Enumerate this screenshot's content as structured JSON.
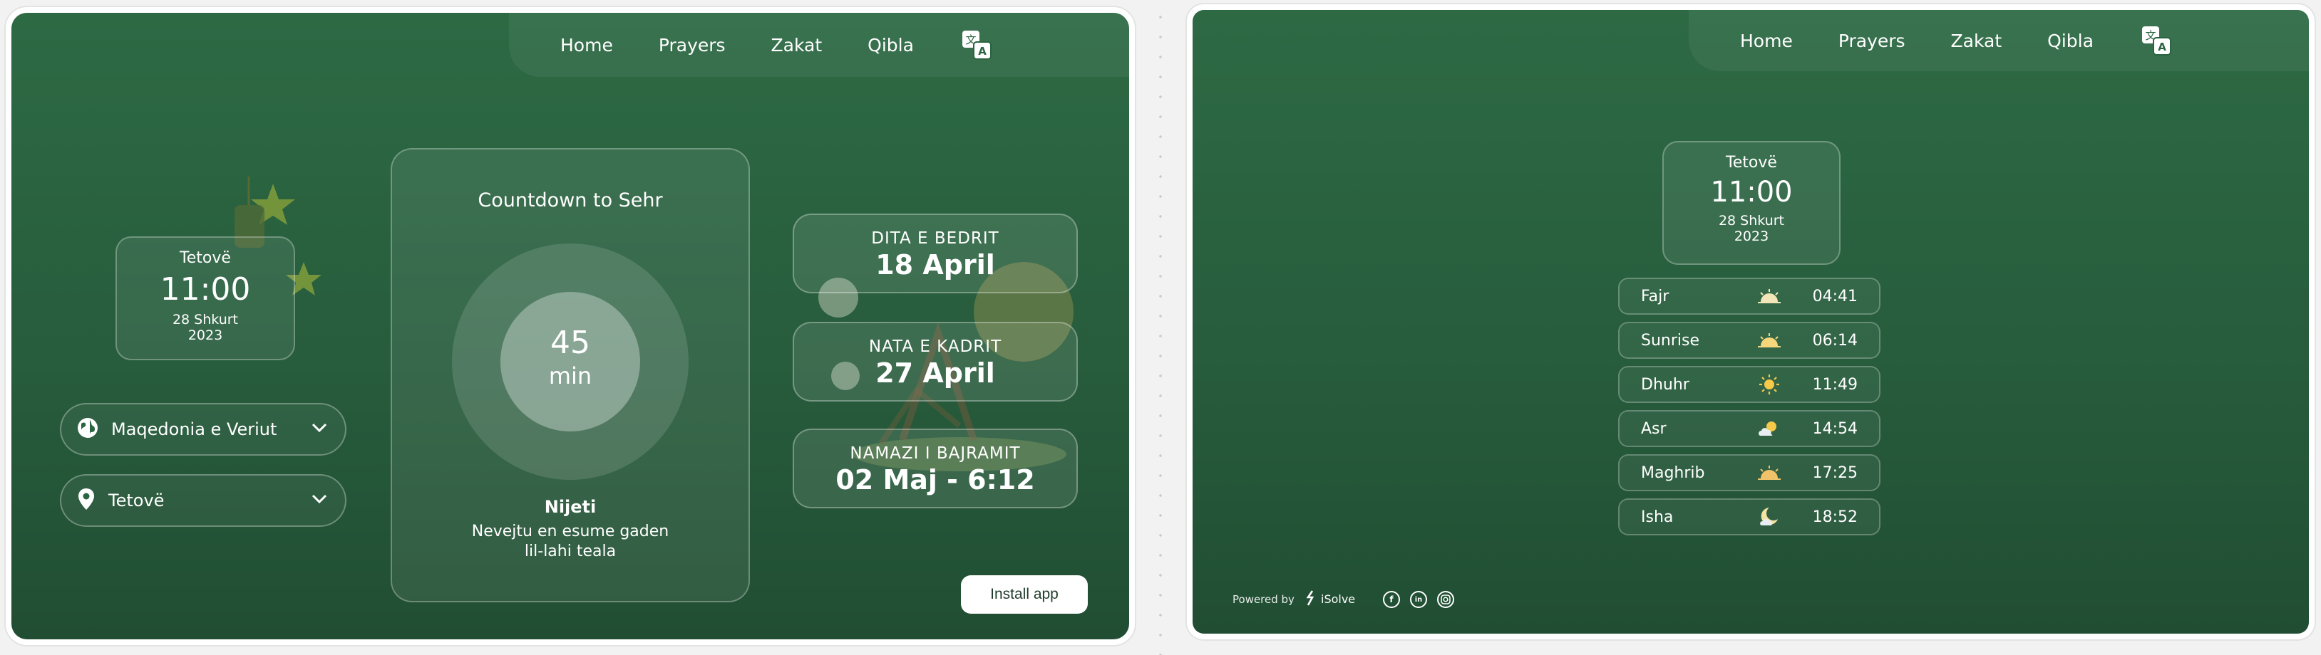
{
  "nav": {
    "home": "Home",
    "prayers": "Prayers",
    "zakat": "Zakat",
    "qibla": "Qibla"
  },
  "icons": {
    "translate": "translate-icon",
    "globe": "globe-icon",
    "pin": "location-pin-icon",
    "chevron": "chevron-down-icon"
  },
  "colors": {
    "background": "#2a6440",
    "accent": "#ffffff",
    "button_text": "#1f3d2a"
  },
  "clock": {
    "city": "Tetovë",
    "time": "11:00",
    "date": "28 Shkurt",
    "year": "2023"
  },
  "selects": {
    "country": "Maqedonia e Veriut",
    "city": "Tetovë"
  },
  "countdown": {
    "title": "Countdown to Sehr",
    "value": "45",
    "unit": "min"
  },
  "intention": {
    "title": "Nijeti",
    "line1": "Nevejtu en esume gaden",
    "line2": "lil-lahi teala"
  },
  "events": [
    {
      "title": "DITA E BEDRIT",
      "date": "18 April"
    },
    {
      "title": "NATA E KADRIT",
      "date": "27 April"
    },
    {
      "title": "NAMAZI I BAJRAMIT",
      "date": "02 Maj - 6:12"
    }
  ],
  "install": "Install app",
  "prayers": [
    {
      "name": "Fajr",
      "icon": "sunrise-icon",
      "time": "04:41"
    },
    {
      "name": "Sunrise",
      "icon": "sunrise-icon",
      "time": "06:14"
    },
    {
      "name": "Dhuhr",
      "icon": "sun-icon",
      "time": "11:49"
    },
    {
      "name": "Asr",
      "icon": "sun-cloud-icon",
      "time": "14:54"
    },
    {
      "name": "Maghrib",
      "icon": "sunset-icon",
      "time": "17:25"
    },
    {
      "name": "Isha",
      "icon": "moon-cloud-icon",
      "time": "18:52"
    }
  ],
  "footer": {
    "powered": "Powered by",
    "brand": "iSolve"
  },
  "social": [
    "facebook-icon",
    "linkedin-icon",
    "instagram-icon"
  ]
}
